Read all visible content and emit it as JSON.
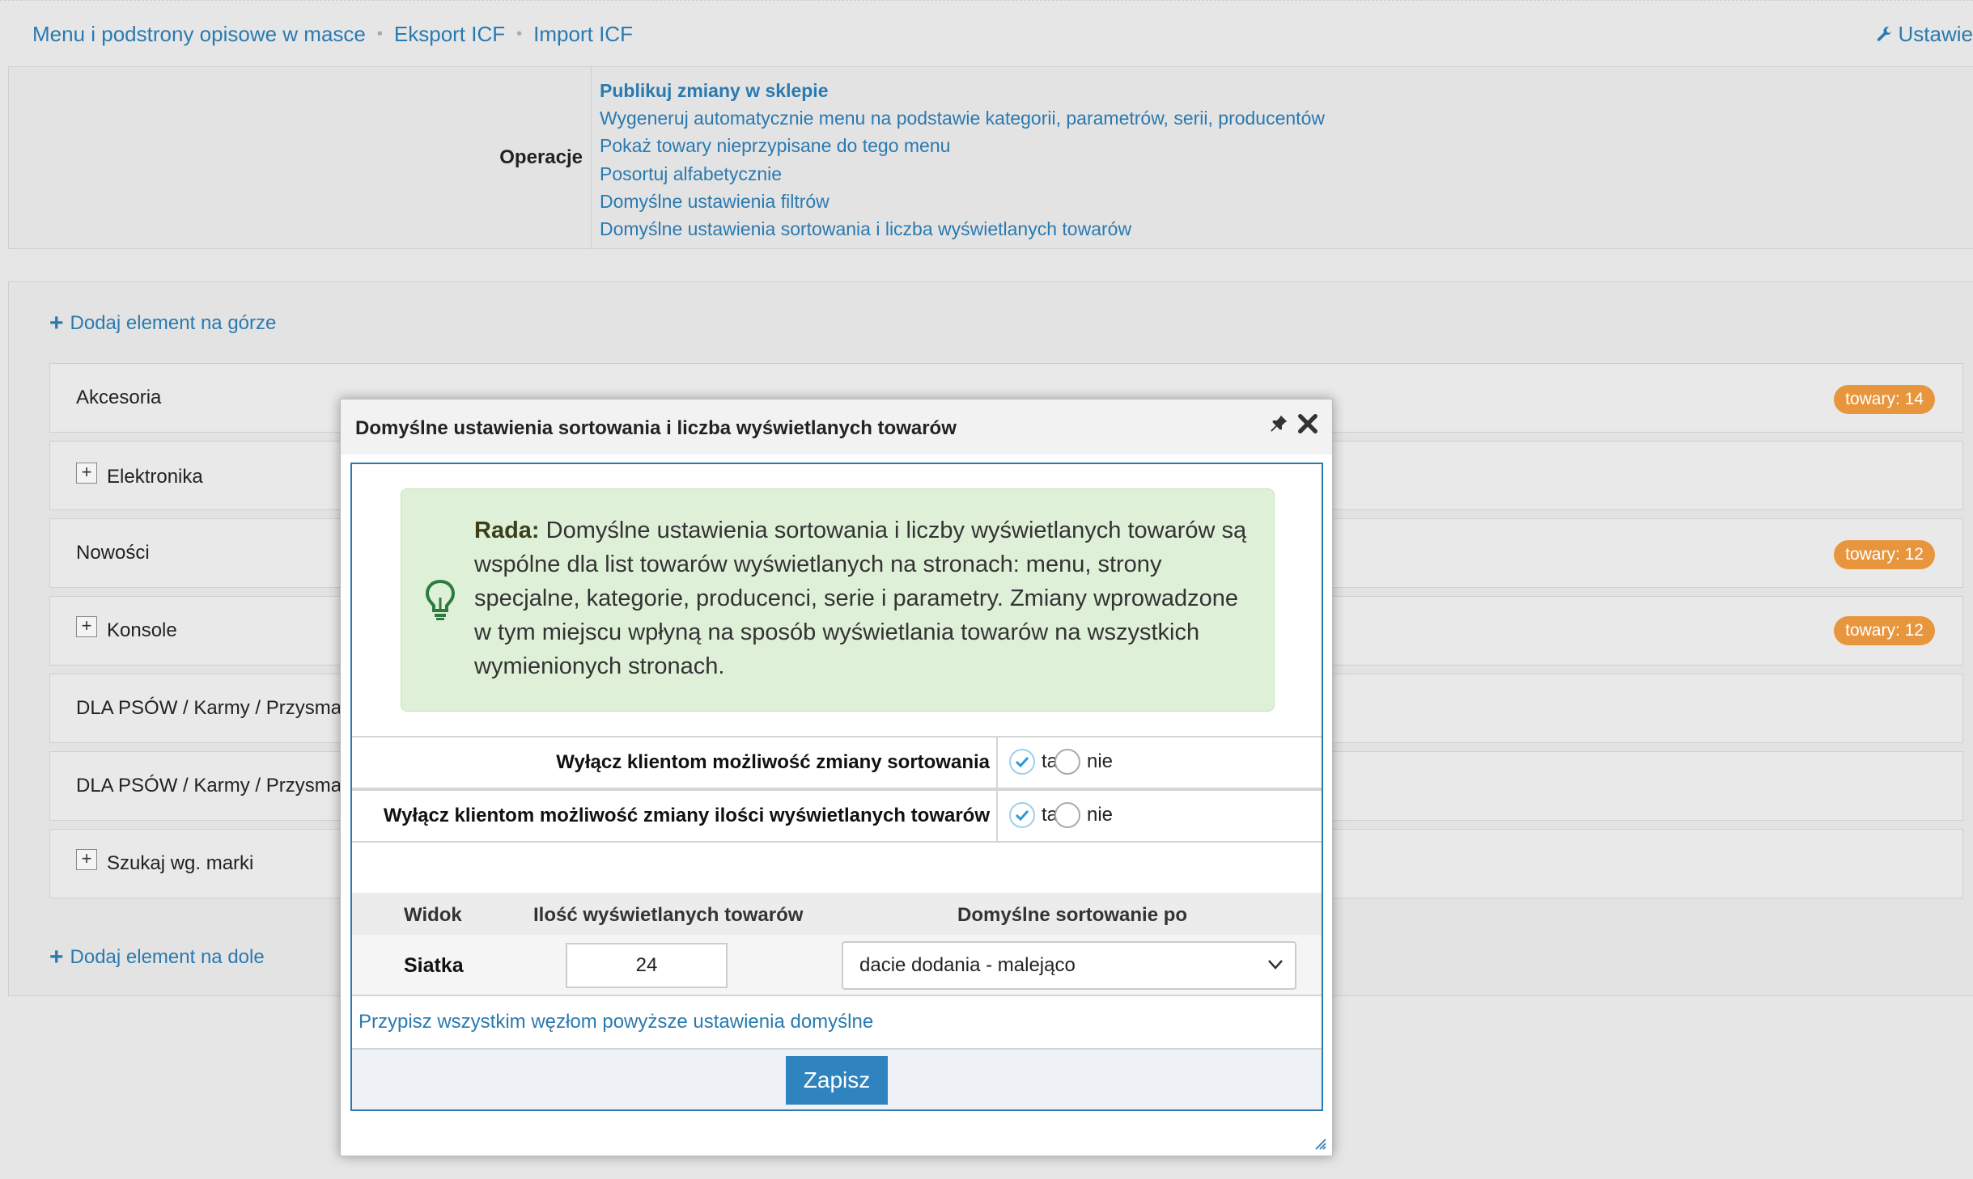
{
  "topnav": {
    "links": [
      "Menu i podstrony opisowe w masce",
      "Eksport ICF",
      "Import ICF"
    ],
    "settings_label": "Ustawie"
  },
  "operations": {
    "label": "Operacje",
    "items": [
      "Publikuj zmiany w sklepie",
      "Wygeneruj automatycznie menu na podstawie kategorii, parametrów, serii, producentów",
      "Pokaż towary nieprzypisane do tego menu",
      "Posortuj alfabetycznie",
      "Domyślne ustawienia filtrów",
      "Domyślne ustawienia sortowania i liczba wyświetlanych towarów"
    ]
  },
  "menu": {
    "add_top": "Dodaj element na górze",
    "add_bottom": "Dodaj element na dole",
    "items": [
      {
        "label": "Akcesoria",
        "badge": "towary: 14"
      },
      {
        "label": "Elektronika",
        "badge": ""
      },
      {
        "label": "Nowości",
        "badge": "towary: 12"
      },
      {
        "label": "Konsole",
        "badge": "towary: 12"
      },
      {
        "label": "DLA PSÓW / Karmy / Przysma",
        "badge": ""
      },
      {
        "label": "DLA PSÓW / Karmy / Przysma",
        "badge": ""
      },
      {
        "label": "Szukaj wg. marki",
        "badge": ""
      }
    ]
  },
  "dialog": {
    "title": "Domyślne ustawienia sortowania i liczba wyświetlanych towarów",
    "tip_bold": "Rada:",
    "tip_text": " Domyślne ustawienia sortowania i liczby wyświetlanych towarów są wspólne dla list towarów wyświetlanych na stronach: menu, strony specjalne, kategorie, producenci, serie i parametry. Zmiany wprowadzone w tym miejscu wpłyną na sposób wyświetlania towarów na wszystkich wymienionych stronach.",
    "option1_label": "Wyłącz klientom możliwość zmiany sortowania",
    "option2_label": "Wyłącz klientom możliwość zmiany ilości wyświetlanych towarów",
    "yes": "tak",
    "no": "nie",
    "col_view": "Widok",
    "col_qty": "Ilość wyświetlanych towarów",
    "col_sort": "Domyślne sortowanie po",
    "row_view": "Siatka",
    "row_qty": "24",
    "row_sort": "dacie dodania - malejąco",
    "assign_link": "Przypisz wszystkim węzłom powyższe ustawienia domyślne",
    "save": "Zapisz"
  },
  "colors": {
    "link": "#2a7ab0",
    "badge": "#e8963e",
    "tip_bg": "#dff0d8",
    "save_bg": "#2f83bf"
  }
}
